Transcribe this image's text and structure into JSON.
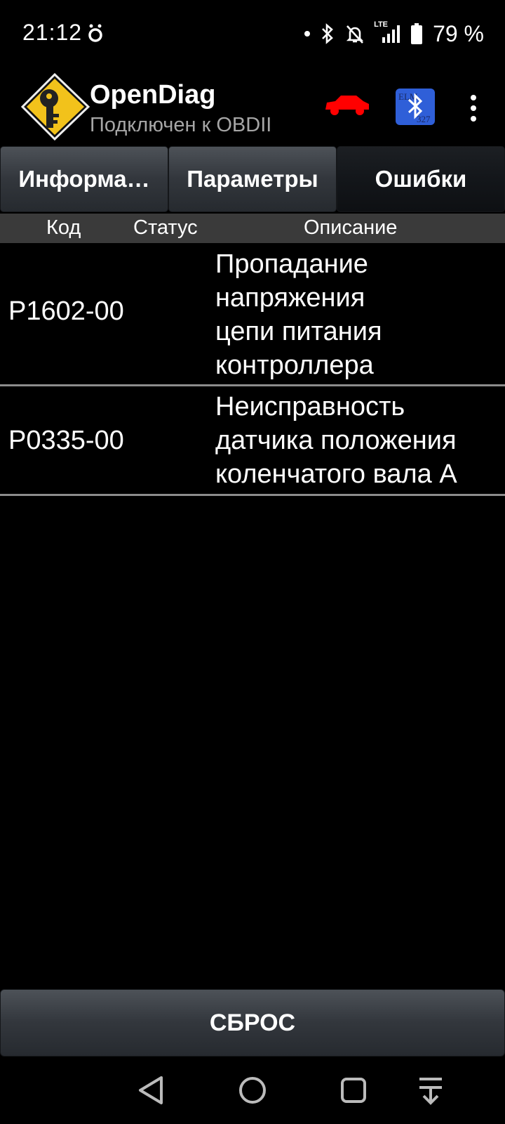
{
  "status_bar": {
    "time": "21:12",
    "battery_percent": "79 %",
    "network": "LTE",
    "icons": [
      "notification-icon",
      "dot-icon",
      "bluetooth-icon",
      "mute-icon",
      "signal-icon",
      "battery-icon"
    ]
  },
  "app": {
    "title": "OpenDiag",
    "subtitle": "Подключен к OBDII",
    "car_status_color": "#ff0000",
    "bluetooth_badge_text": "ELM 327"
  },
  "tabs": [
    {
      "label": "Информа…",
      "active": false
    },
    {
      "label": "Параметры",
      "active": false
    },
    {
      "label": "Ошибки",
      "active": true
    }
  ],
  "table": {
    "headers": {
      "code": "Код",
      "status": "Статус",
      "description": "Описание"
    },
    "rows": [
      {
        "code": "P1602-00",
        "status": "",
        "description_lines": [
          "Пропадание",
          "напряжения",
          "цепи питания",
          "контроллера"
        ]
      },
      {
        "code": "P0335-00",
        "status": "",
        "description_lines": [
          "Неисправность",
          "датчика положения",
          "коленчатого вала А"
        ]
      }
    ]
  },
  "actions": {
    "reset_label": "СБРОС"
  },
  "nav": [
    "back-icon",
    "home-icon",
    "recents-icon",
    "hide-nav-icon"
  ]
}
